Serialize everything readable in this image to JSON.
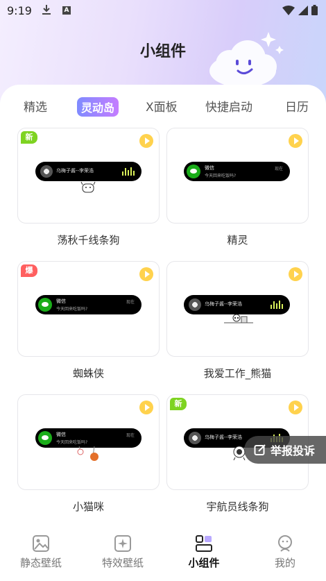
{
  "status_bar": {
    "time": "9:19",
    "notification_icons": [
      "download-icon",
      "a-icon"
    ],
    "right_icons": [
      "wifi-icon",
      "signal-icon",
      "battery-icon"
    ]
  },
  "header": {
    "title": "小组件"
  },
  "tabs": [
    {
      "label": "精选",
      "active": false
    },
    {
      "label": "灵动岛",
      "active": true
    },
    {
      "label": "X面板",
      "active": false
    },
    {
      "label": "快捷启动",
      "active": false
    },
    {
      "label": "日历",
      "active": false
    }
  ],
  "cards": [
    {
      "label": "荡秋千线条狗",
      "badge": "新",
      "island": {
        "type": "music",
        "song": "乌梅子酱--李荣浩"
      }
    },
    {
      "label": "精灵",
      "badge": "",
      "island": {
        "type": "message",
        "title": "微信",
        "body": "今天回来吃饭吗?",
        "time": "现在"
      }
    },
    {
      "label": "蜘蛛侠",
      "badge": "爆",
      "island": {
        "type": "message",
        "title": "微信",
        "body": "今天回来吃饭吗?",
        "time": "现在"
      }
    },
    {
      "label": "我爱工作_熊猫",
      "badge": "",
      "island": {
        "type": "music",
        "song": "乌梅子酱--李荣浩"
      }
    },
    {
      "label": "小猫咪",
      "badge": "",
      "island": {
        "type": "message",
        "title": "微信",
        "body": "今天回来吃饭吗?",
        "time": "现在"
      }
    },
    {
      "label": "宇航员线条狗",
      "badge": "新",
      "island": {
        "type": "music",
        "song": "乌梅子酱--李荣浩"
      }
    }
  ],
  "report_button": {
    "label": "举报投诉"
  },
  "bottom_nav": [
    {
      "label": "静态壁纸",
      "icon": "image-icon",
      "active": false
    },
    {
      "label": "特效壁纸",
      "icon": "sparkle-image-icon",
      "active": false
    },
    {
      "label": "小组件",
      "icon": "widget-icon",
      "active": true
    },
    {
      "label": "我的",
      "icon": "profile-icon",
      "active": false
    }
  ],
  "colors": {
    "accent_gradient_start": "#7f8bff",
    "accent_gradient_end": "#c57dff",
    "badge_new": "#7ed321",
    "badge_hot": "#ff5f5f",
    "play": "#ffd24d"
  }
}
